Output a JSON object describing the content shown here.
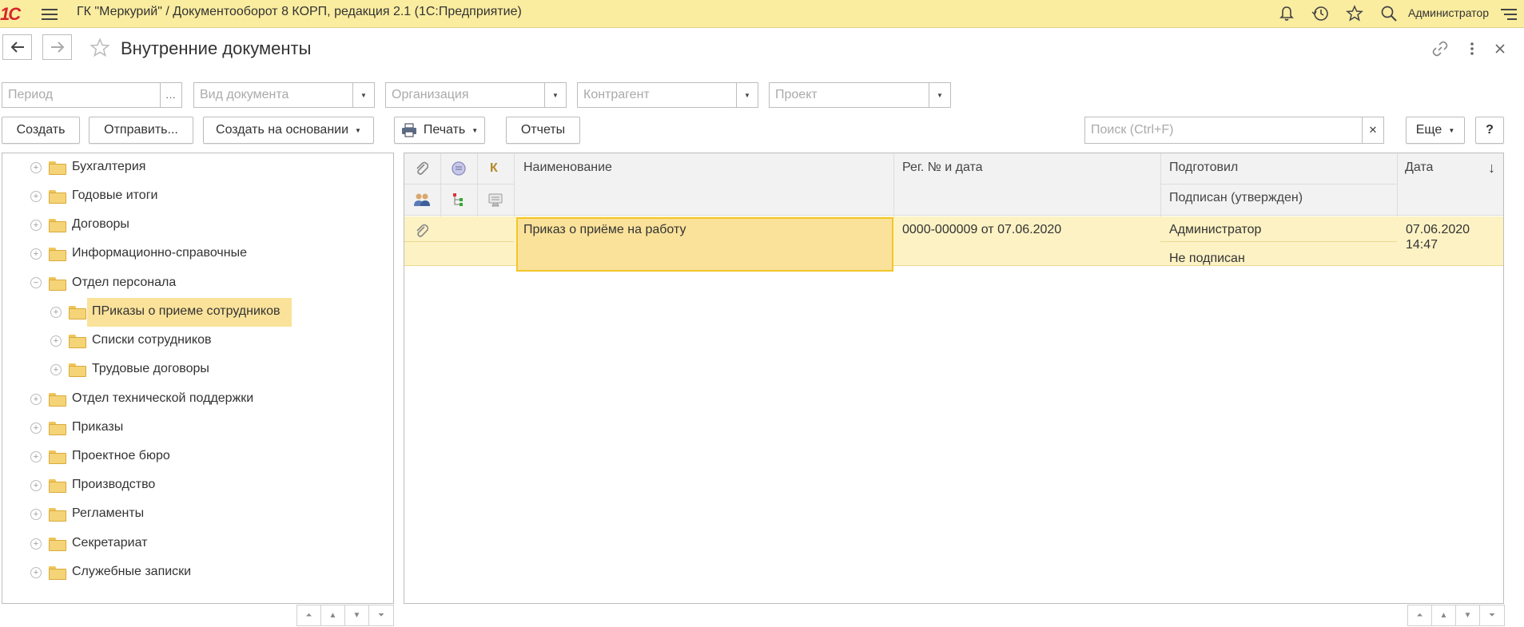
{
  "app": {
    "title": "ГК \"Меркурий\" / Документооборот 8 КОРП, редакция 2.1  (1С:Предприятие)",
    "user": "Администратор",
    "logo": "1С"
  },
  "header": {
    "title": "Внутренние документы"
  },
  "filters": {
    "period_placeholder": "Период",
    "period_button": "...",
    "doc_type_placeholder": "Вид документа",
    "org_placeholder": "Организация",
    "counterparty_placeholder": "Контрагент",
    "project_placeholder": "Проект"
  },
  "toolbar": {
    "create": "Создать",
    "send": "Отправить...",
    "create_based": "Создать на основании",
    "print": "Печать",
    "reports": "Отчеты",
    "search_placeholder": "Поиск (Ctrl+F)",
    "more": "Еще",
    "help": "?"
  },
  "tree": {
    "items": [
      {
        "label": "Бухгалтерия"
      },
      {
        "label": "Годовые итоги"
      },
      {
        "label": "Договоры"
      },
      {
        "label": "Информационно-справочные"
      },
      {
        "label": "Отдел персонала"
      },
      {
        "label": "ПРиказы о приеме сотрудников"
      },
      {
        "label": "Списки сотрудников"
      },
      {
        "label": "Трудовые договоры"
      },
      {
        "label": "Отдел технической поддержки"
      },
      {
        "label": "Приказы"
      },
      {
        "label": "Проектное бюро"
      },
      {
        "label": "Производство"
      },
      {
        "label": "Регламенты"
      },
      {
        "label": "Секретариат"
      },
      {
        "label": "Служебные записки"
      }
    ]
  },
  "grid": {
    "columns": {
      "k": "К",
      "name": "Наименование",
      "reg": "Рег. № и дата",
      "prepared": "Подготовил",
      "signed": "Подписан (утвержден)",
      "date": "Дата",
      "sort": "↓"
    },
    "rows": [
      {
        "name": "Приказ о приёме на работу",
        "reg": "0000-000009 от 07.06.2020",
        "prepared": "Администратор",
        "signed": "Не подписан",
        "date": "07.06.2020",
        "time": "14:47"
      }
    ]
  },
  "colors": {
    "topbar": "#fbeda0",
    "selection": "#fbe29a",
    "row_highlight": "#fdf2c4",
    "logo": "#d6262b"
  }
}
